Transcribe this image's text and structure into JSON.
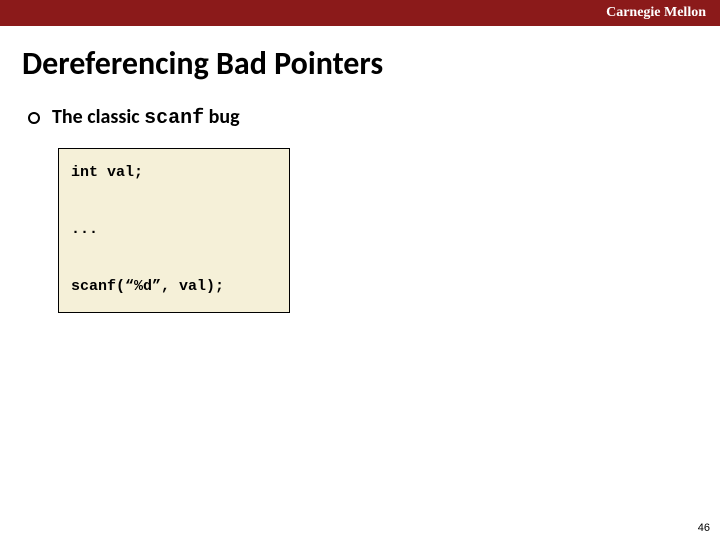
{
  "header": {
    "institution": "Carnegie Mellon"
  },
  "slide": {
    "title": "Dereferencing Bad Pointers",
    "bullet_prefix": "The classic ",
    "bullet_mono": "scanf",
    "bullet_suffix": " bug",
    "code": "int val;\n\n...\n\nscanf(“%d”, val);",
    "page_number": "46"
  }
}
